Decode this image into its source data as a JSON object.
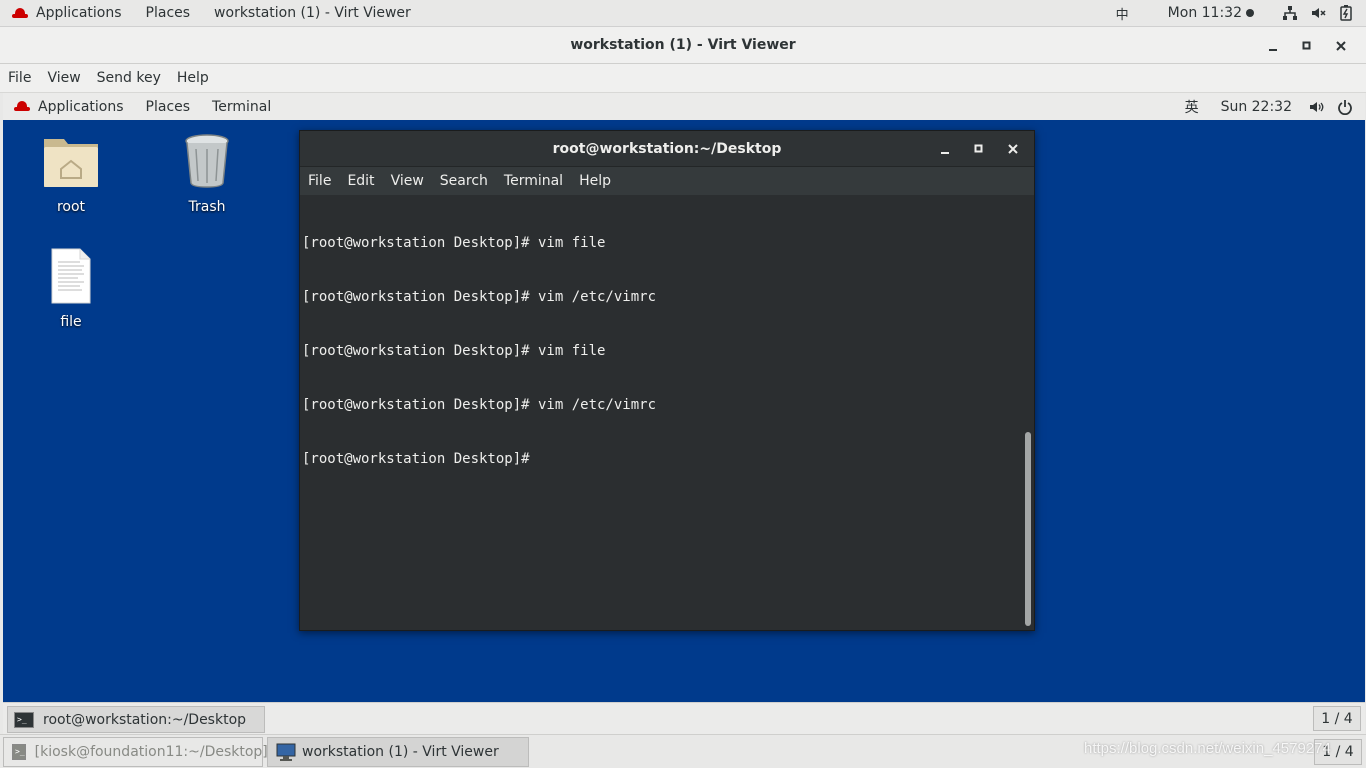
{
  "host": {
    "topbar": {
      "applications": "Applications",
      "places": "Places",
      "window_title": "workstation (1) - Virt Viewer",
      "ime": "中",
      "clock": "Mon 11:32"
    },
    "window": {
      "title": "workstation (1) - Virt Viewer",
      "menu": [
        "File",
        "View",
        "Send key",
        "Help"
      ]
    },
    "taskbar": {
      "items": [
        "[kiosk@foundation11:~/Desktop]",
        "workstation (1) - Virt Viewer"
      ],
      "workspace": "1 / 4"
    },
    "watermark": "https://blog.csdn.net/weixin_4579274"
  },
  "guest": {
    "topbar": {
      "applications": "Applications",
      "places": "Places",
      "terminal": "Terminal",
      "ime": "英",
      "clock": "Sun 22:32"
    },
    "desktop_icons": {
      "root": "root",
      "trash": "Trash",
      "file": "file"
    },
    "terminal": {
      "title": "root@workstation:~/Desktop",
      "menu": [
        "File",
        "Edit",
        "View",
        "Search",
        "Terminal",
        "Help"
      ],
      "lines": [
        "[root@workstation Desktop]# vim file",
        "[root@workstation Desktop]# vim /etc/vimrc",
        "[root@workstation Desktop]# vim file",
        "[root@workstation Desktop]# vim /etc/vimrc",
        "[root@workstation Desktop]# "
      ]
    },
    "taskbar": {
      "item": "root@workstation:~/Desktop",
      "workspace": "1 / 4"
    }
  }
}
